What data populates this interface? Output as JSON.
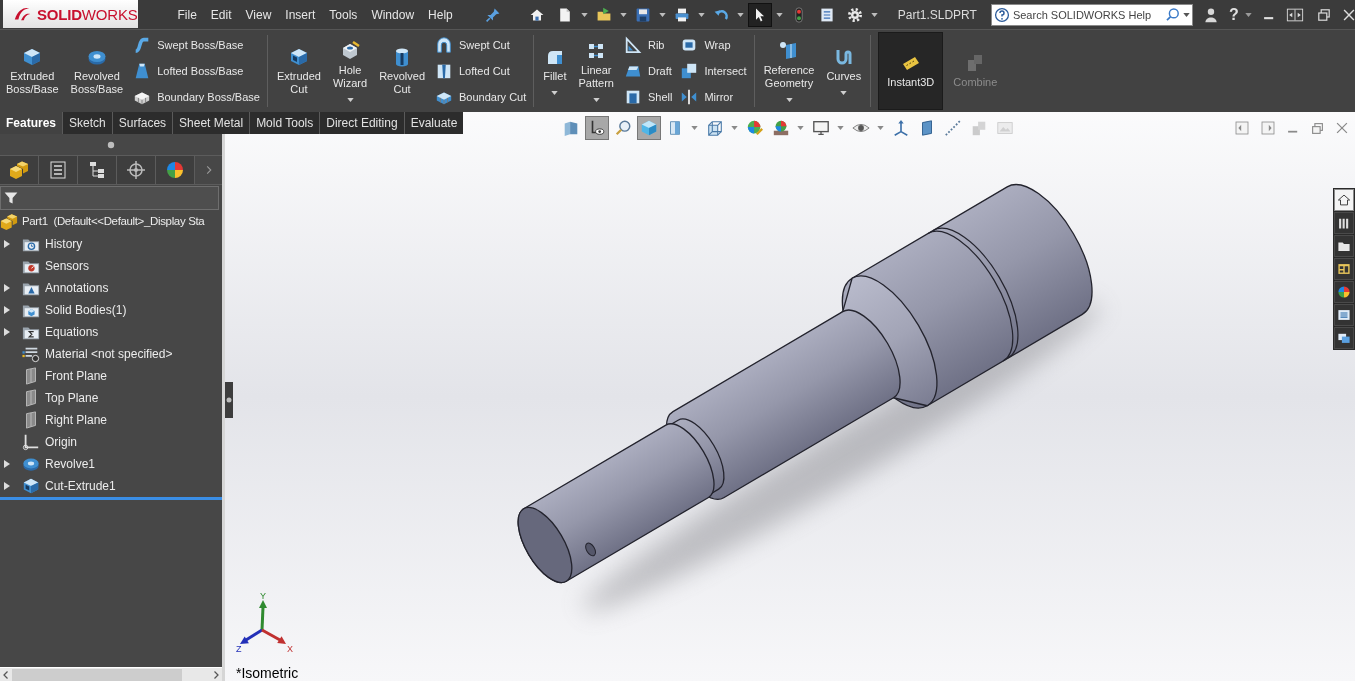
{
  "title_bar": {
    "logo": "**SOLID**WORKS",
    "menu": [
      "File",
      "Edit",
      "View",
      "Insert",
      "Tools",
      "Window",
      "Help"
    ],
    "quick_access": [
      {
        "dropdown": false,
        "on": false
      },
      {
        "dropdown": true,
        "on": false
      },
      {
        "dropdown": true,
        "on": false
      },
      {
        "dropdown": true,
        "on": false
      },
      {
        "dropdown": true,
        "on": false
      },
      {
        "dropdown": true,
        "on": false
      },
      {
        "dropdown": true,
        "on": true
      },
      {
        "dropdown": false,
        "on": false
      },
      {
        "dropdown": false,
        "on": false
      },
      {
        "dropdown": true,
        "on": false
      }
    ],
    "document_title": "Part1.SLDPRT",
    "search": {
      "placeholder": "Search SOLIDWORKS Help"
    },
    "help_button": "?"
  },
  "ribbon": {
    "groups": [
      {
        "items": [
          {
            "kind": "large",
            "label": "Extruded Boss/Base",
            "dropdown": false,
            "on": false,
            "disabled": false
          },
          {
            "kind": "large",
            "label": "Revolved Boss/Base",
            "dropdown": false,
            "on": false,
            "disabled": false
          },
          {
            "kind": "stack",
            "labels": [
              "Swept Boss/Base",
              "Lofted Boss/Base",
              "Boundary Boss/Base"
            ]
          }
        ]
      },
      {
        "items": [
          {
            "kind": "large",
            "label": "Extruded Cut",
            "dropdown": false,
            "on": false,
            "disabled": false
          },
          {
            "kind": "large",
            "label": "Hole Wizard",
            "dropdown": true,
            "on": false,
            "disabled": false
          },
          {
            "kind": "large",
            "label": "Revolved Cut",
            "dropdown": false,
            "on": false,
            "disabled": false
          },
          {
            "kind": "stack",
            "labels": [
              "Swept Cut",
              "Lofted Cut",
              "Boundary Cut"
            ]
          }
        ]
      },
      {
        "items": [
          {
            "kind": "large",
            "label": "Fillet",
            "dropdown": true,
            "on": false,
            "disabled": false
          },
          {
            "kind": "large",
            "label": "Linear Pattern",
            "dropdown": true,
            "on": false,
            "disabled": false
          },
          {
            "kind": "stack",
            "labels": [
              "Rib",
              "Draft",
              "Shell"
            ]
          },
          {
            "kind": "stack",
            "labels": [
              "Wrap",
              "Intersect",
              "Mirror"
            ]
          }
        ]
      },
      {
        "items": [
          {
            "kind": "large",
            "label": "Reference Geometry",
            "dropdown": true,
            "on": false,
            "disabled": false
          },
          {
            "kind": "large",
            "label": "Curves",
            "dropdown": true,
            "on": false,
            "disabled": false
          }
        ]
      },
      {
        "items": [
          {
            "kind": "large",
            "label": "Instant3D",
            "dropdown": false,
            "on": true,
            "disabled": false
          },
          {
            "kind": "large",
            "label": "Combine",
            "dropdown": false,
            "on": false,
            "disabled": true
          }
        ]
      }
    ]
  },
  "command_tabs": [
    {
      "label": "Features",
      "selected": true
    },
    {
      "label": "Sketch",
      "selected": false
    },
    {
      "label": "Surfaces",
      "selected": false
    },
    {
      "label": "Sheet Metal",
      "selected": false
    },
    {
      "label": "Mold Tools",
      "selected": false
    },
    {
      "label": "Direct Editing",
      "selected": false
    },
    {
      "label": "Evaluate",
      "selected": false
    }
  ],
  "feature_manager": {
    "tree": {
      "label": "Part1  (Default<<Default>_Display Sta",
      "children": [
        {
          "label": "History",
          "expandable": true
        },
        {
          "label": "Sensors",
          "expandable": false
        },
        {
          "label": "Annotations",
          "expandable": true
        },
        {
          "label": "Solid Bodies(1)",
          "expandable": true
        },
        {
          "label": "Equations",
          "expandable": true
        },
        {
          "label": "Material <not specified>",
          "expandable": false
        },
        {
          "label": "Front Plane",
          "expandable": false
        },
        {
          "label": "Top Plane",
          "expandable": false
        },
        {
          "label": "Right Plane",
          "expandable": false
        },
        {
          "label": "Origin",
          "expandable": false
        },
        {
          "label": "Revolve1",
          "expandable": true
        },
        {
          "label": "Cut-Extrude1",
          "expandable": true
        }
      ]
    }
  },
  "view_toolbar": [
    {
      "on": false,
      "dropdown": false,
      "disabled": false
    },
    {
      "on": true,
      "dropdown": false,
      "disabled": false
    },
    {
      "on": false,
      "dropdown": false,
      "disabled": false
    },
    {
      "on": true,
      "dropdown": false,
      "disabled": false
    },
    {
      "on": false,
      "dropdown": true,
      "disabled": false
    },
    {
      "on": false,
      "dropdown": true,
      "disabled": false
    },
    {
      "on": false,
      "dropdown": false,
      "disabled": false
    },
    {
      "on": false,
      "dropdown": true,
      "disabled": false
    },
    {
      "on": false,
      "dropdown": true,
      "disabled": false
    },
    {
      "on": false,
      "dropdown": true,
      "disabled": false
    },
    {
      "on": false,
      "dropdown": false,
      "disabled": false
    },
    {
      "on": false,
      "dropdown": false,
      "disabled": false
    },
    {
      "on": false,
      "dropdown": false,
      "disabled": false
    },
    {
      "on": false,
      "dropdown": false,
      "disabled": true
    },
    {
      "on": false,
      "dropdown": false,
      "disabled": true
    }
  ],
  "task_pane": [
    {
      "selected": true
    },
    {
      "selected": false
    },
    {
      "selected": false
    },
    {
      "selected": false
    },
    {
      "selected": false
    },
    {
      "selected": false
    },
    {
      "selected": false
    }
  ],
  "view_triad": [
    {
      "label": "Y",
      "color": "#2f8a2f"
    },
    {
      "label": "Z",
      "color": "#2330b8"
    },
    {
      "label": "X",
      "color": "#c03030"
    }
  ],
  "view_label": "*Isometric"
}
